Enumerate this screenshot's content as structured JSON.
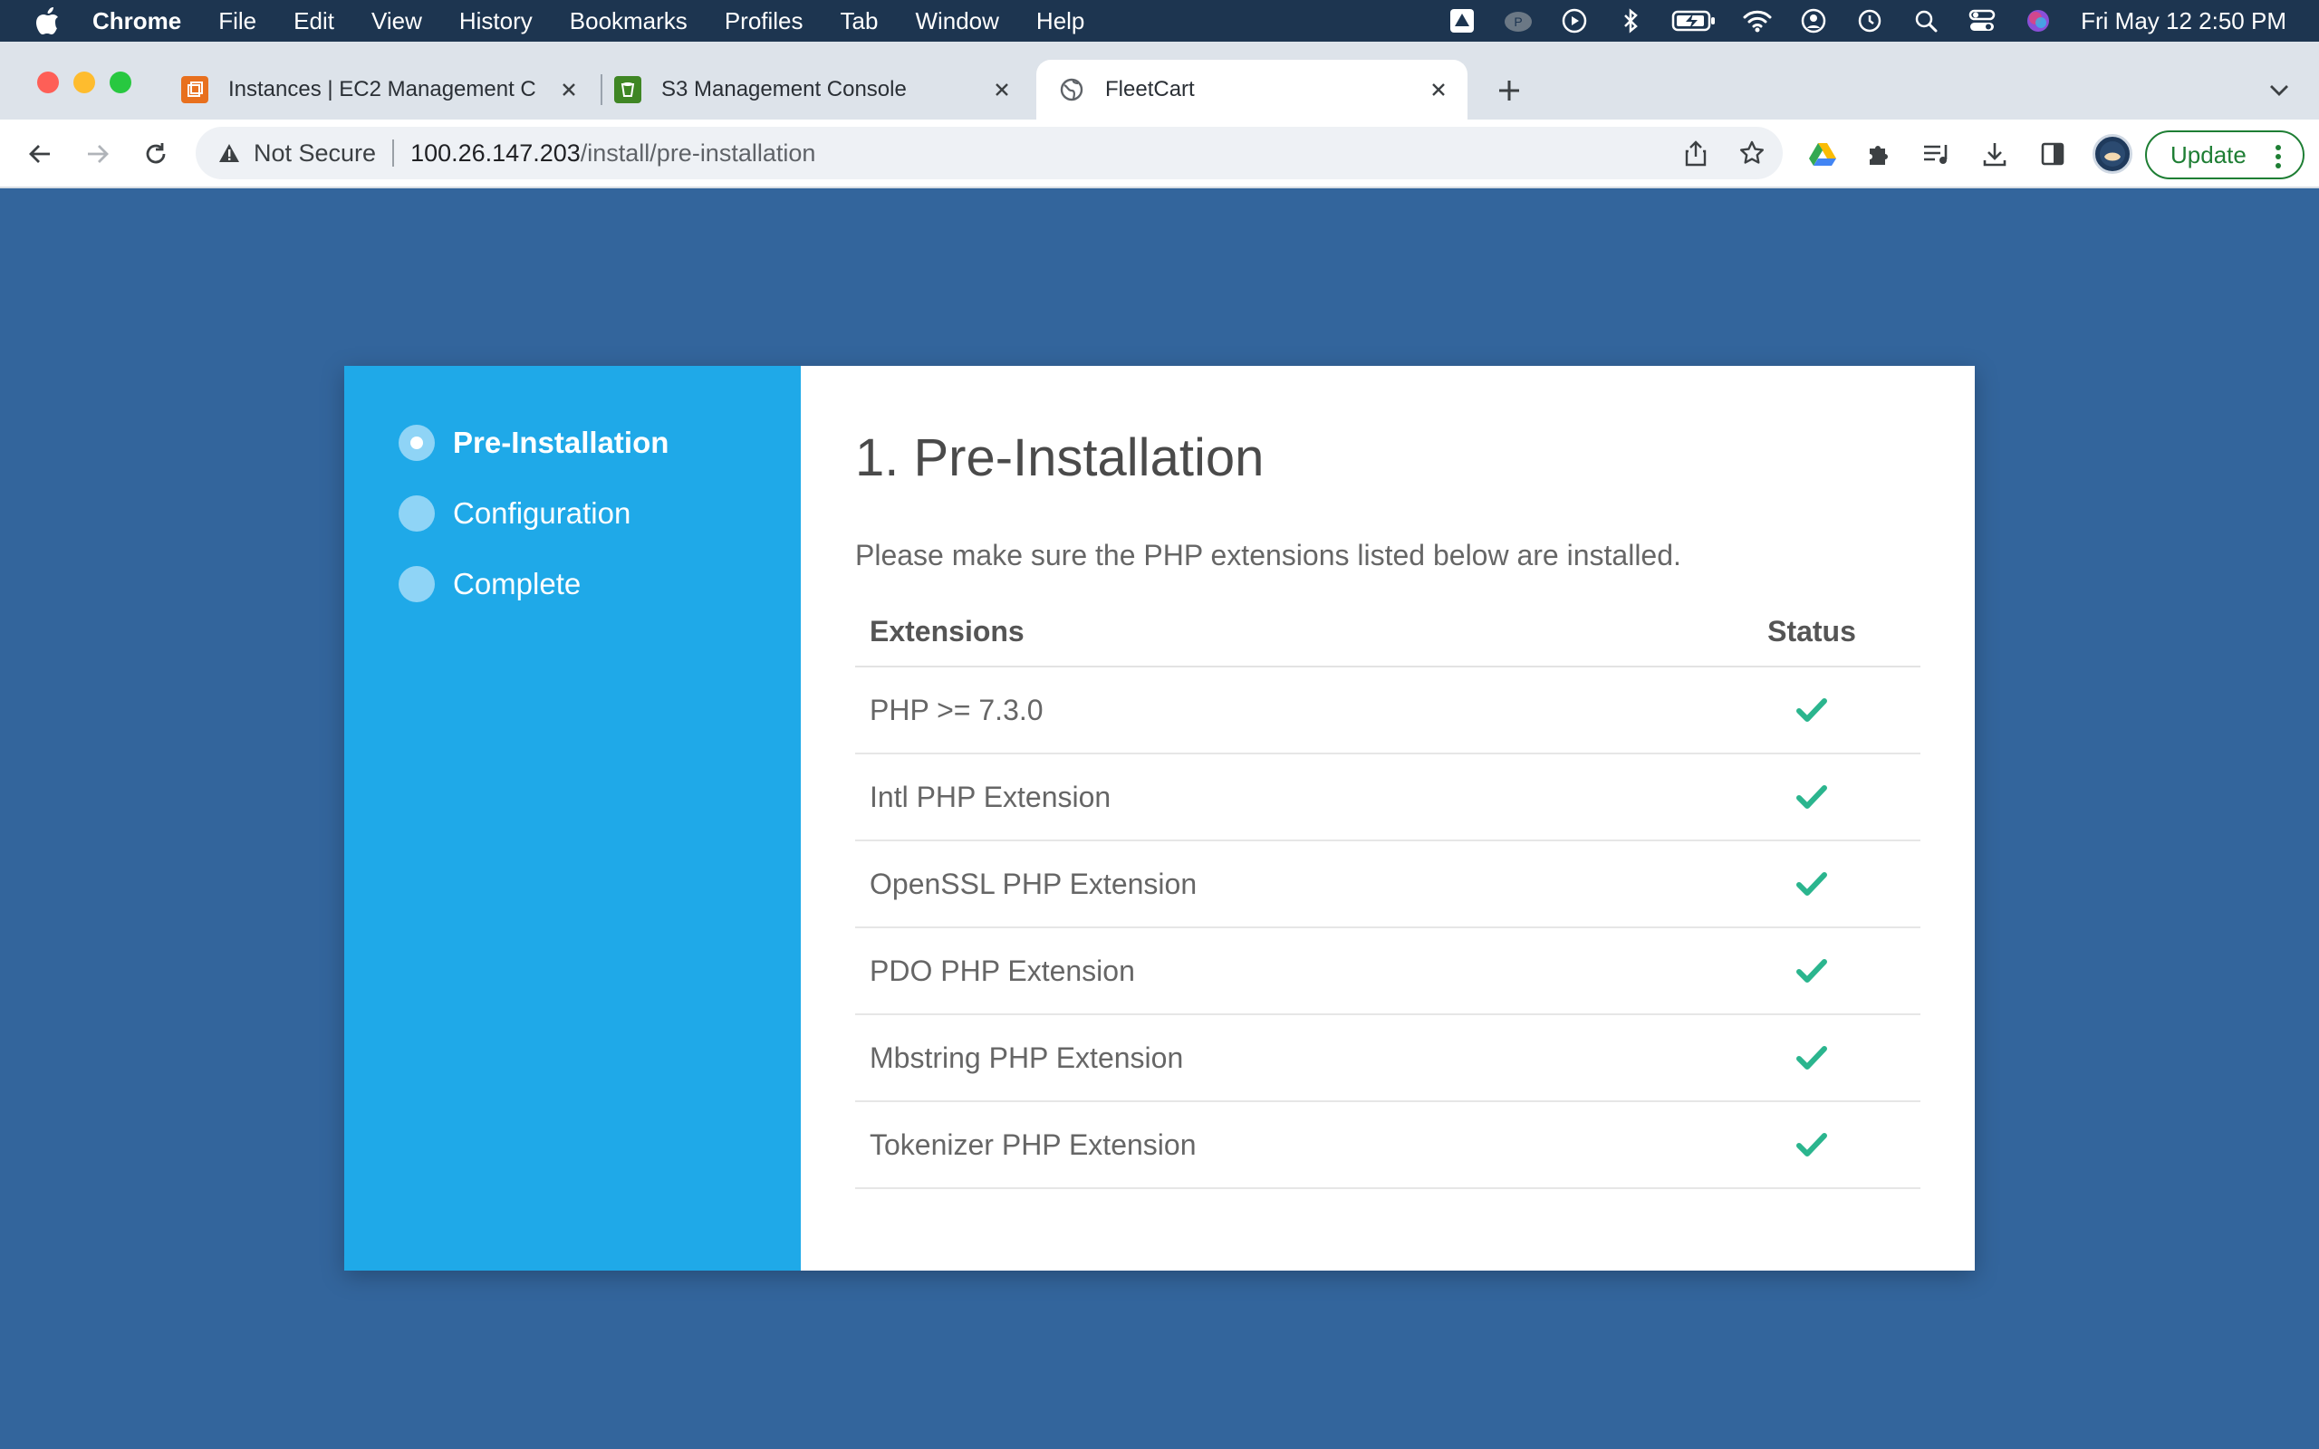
{
  "menubar": {
    "app_name": "Chrome",
    "items": [
      "File",
      "Edit",
      "View",
      "History",
      "Bookmarks",
      "Profiles",
      "Tab",
      "Window",
      "Help"
    ],
    "clock": "Fri May 12  2:50 PM"
  },
  "tabs": [
    {
      "title": "Instances | EC2 Management C",
      "favicon": "ec2-icon",
      "favicon_color": "#e8701e"
    },
    {
      "title": "S3 Management Console",
      "favicon": "s3-icon",
      "favicon_color": "#3f8624"
    },
    {
      "title": "FleetCart",
      "favicon": "globe-icon",
      "favicon_color": "#5f6368"
    }
  ],
  "toolbar": {
    "security_label": "Not Secure",
    "url_host": "100.26.147.203",
    "url_path": "/install/pre-installation",
    "update_label": "Update"
  },
  "installer": {
    "steps": [
      {
        "label": "Pre-Installation",
        "active": true
      },
      {
        "label": "Configuration",
        "active": false
      },
      {
        "label": "Complete",
        "active": false
      }
    ],
    "title": "1. Pre-Installation",
    "intro": "Please make sure the PHP extensions listed below are installed.",
    "table": {
      "headers": [
        "Extensions",
        "Status"
      ],
      "rows": [
        {
          "name": "PHP >= 7.3.0",
          "status": "check-icon"
        },
        {
          "name": "Intl PHP Extension",
          "status": "check-icon"
        },
        {
          "name": "OpenSSL PHP Extension",
          "status": "check-icon"
        },
        {
          "name": "PDO PHP Extension",
          "status": "check-icon"
        },
        {
          "name": "Mbstring PHP Extension",
          "status": "check-icon"
        },
        {
          "name": "Tokenizer PHP Extension",
          "status": "check-icon"
        }
      ]
    }
  },
  "colors": {
    "page_background": "#33659c",
    "sidebar": "#1fa9e8",
    "check": "#2bb58e",
    "update_green": "#1e7e34"
  }
}
